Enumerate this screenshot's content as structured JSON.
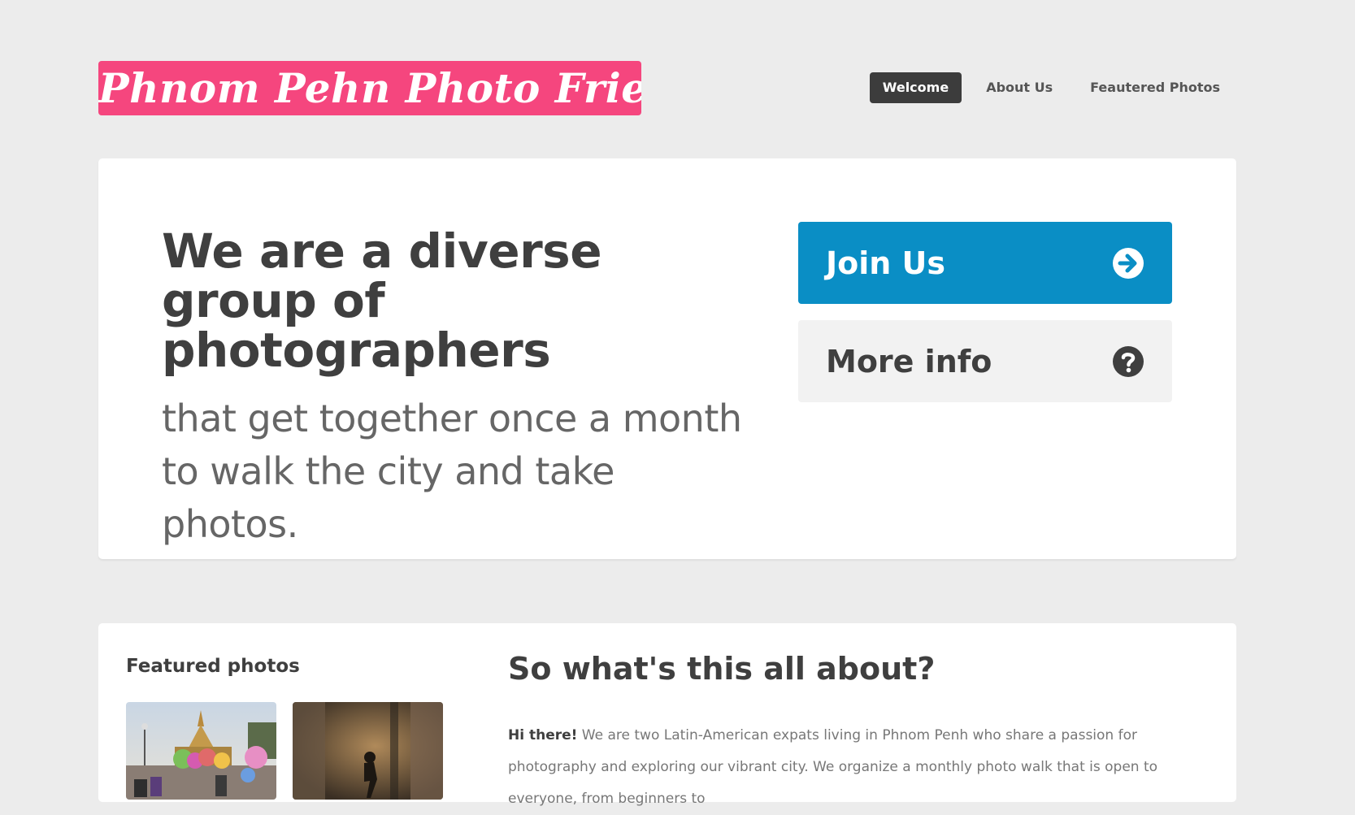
{
  "header": {
    "logo_text": "Phnom Pehn Photo Friends",
    "nav": [
      {
        "label": "Welcome",
        "active": true
      },
      {
        "label": "About Us",
        "active": false
      },
      {
        "label": "Feautered Photos",
        "active": false
      }
    ]
  },
  "hero": {
    "heading": "We are a diverse group of photographers",
    "subheading": "that get together once a month to walk the city and take photos.",
    "primary_button": {
      "label": "Join Us",
      "icon": "arrow-right-circle-icon"
    },
    "secondary_button": {
      "label": "More info",
      "icon": "question-circle-icon"
    }
  },
  "featured": {
    "title": "Featured photos",
    "photos": [
      {
        "icon": "temple-photo"
      },
      {
        "icon": "silhouette-photo"
      }
    ]
  },
  "about": {
    "title": "So what's this all about?",
    "lead": "Hi there!",
    "body": " We are two Latin-American expats living in Phnom Penh who share a passion for photography and exploring our vibrant city. We organize a monthly photo walk that is open to everyone, from beginners to"
  },
  "colors": {
    "brand_pink": "#f5467e",
    "primary_blue": "#0a8ec5",
    "dark": "#3c3c3c",
    "page_bg": "#ececec"
  }
}
